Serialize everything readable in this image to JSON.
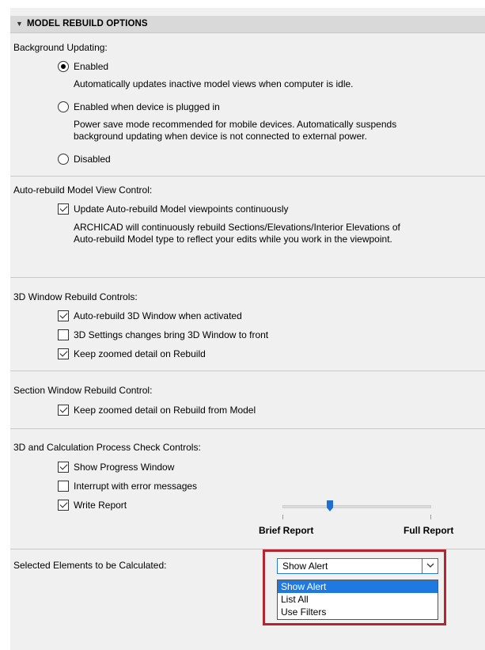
{
  "header": {
    "title": "MODEL REBUILD OPTIONS"
  },
  "background_updating": {
    "heading": "Background Updating:",
    "options": [
      {
        "label": "Enabled",
        "checked": true,
        "desc": [
          "Automatically updates inactive model views when computer is idle."
        ]
      },
      {
        "label": "Enabled when device is plugged in",
        "checked": false,
        "desc": [
          "Power save mode recommended for mobile devices. Automatically suspends",
          "background updating when device is not connected to external power."
        ]
      },
      {
        "label": "Disabled",
        "checked": false,
        "desc": []
      }
    ]
  },
  "auto_rebuild": {
    "heading": "Auto-rebuild Model View Control:",
    "checkbox": {
      "label": "Update Auto-rebuild Model viewpoints continuously",
      "checked": true
    },
    "desc": [
      "ARCHICAD will continuously rebuild Sections/Elevations/Interior Elevations of",
      "Auto-rebuild Model type to reflect your edits while you work in the viewpoint."
    ]
  },
  "window_3d": {
    "heading": "3D Window Rebuild Controls:",
    "checkboxes": [
      {
        "label": "Auto-rebuild 3D Window when activated",
        "checked": true
      },
      {
        "label": "3D Settings changes bring 3D Window to front",
        "checked": false
      },
      {
        "label": "Keep zoomed detail on Rebuild",
        "checked": true
      }
    ]
  },
  "section_window": {
    "heading": "Section Window Rebuild Control:",
    "checkbox": {
      "label": "Keep zoomed detail on Rebuild from Model",
      "checked": true
    }
  },
  "calc_controls": {
    "heading": "3D and Calculation Process Check Controls:",
    "checkboxes": [
      {
        "label": "Show Progress Window",
        "checked": true
      },
      {
        "label": "Interrupt with error messages",
        "checked": false
      },
      {
        "label": "Write Report",
        "checked": true
      }
    ],
    "slider": {
      "min_label": "Brief Report",
      "max_label": "Full Report",
      "level": 0.4
    }
  },
  "selected_elements": {
    "label": "Selected Elements to be Calculated:",
    "value": "Show Alert",
    "options": [
      "Show Alert",
      "List All",
      "Use Filters"
    ],
    "highlight_color": "#b3262d"
  }
}
